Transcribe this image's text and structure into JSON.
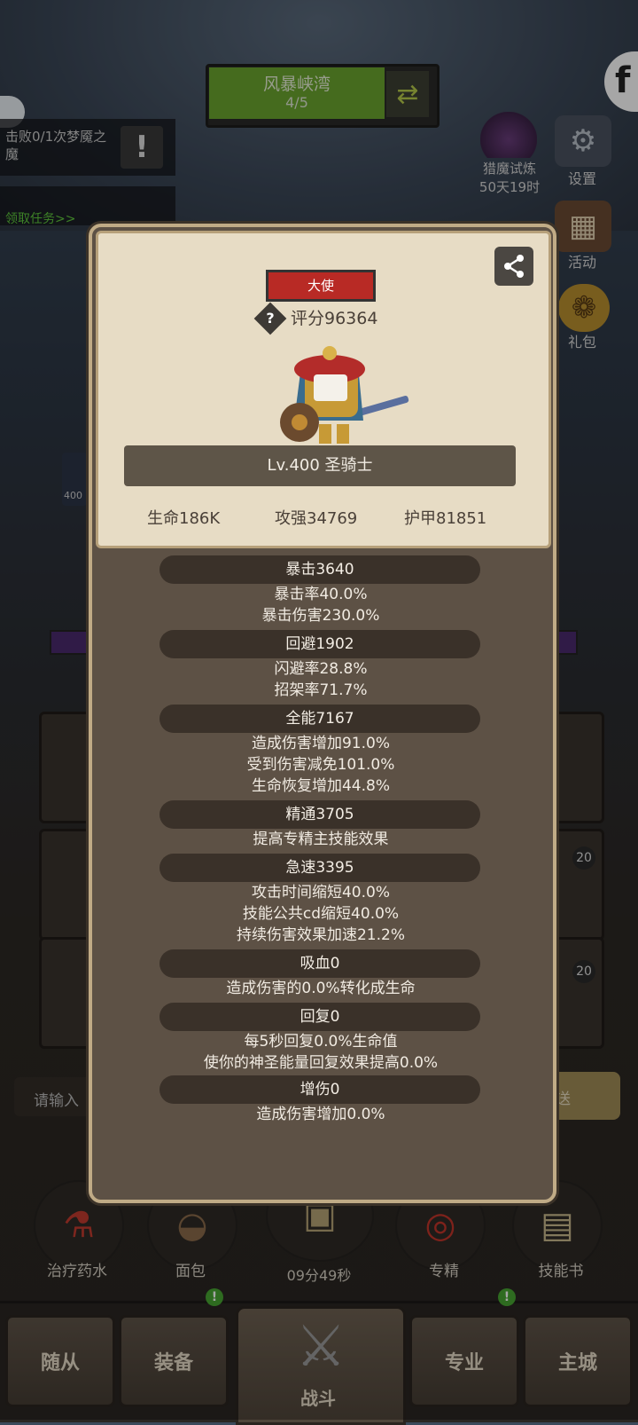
{
  "zone": {
    "title": "风暴峡湾",
    "progress": "4/5"
  },
  "quests": [
    {
      "text": "击败0/1次梦魇之魔"
    },
    {
      "text": "领取任务>>"
    }
  ],
  "hunt_trial": {
    "title": "猎魔试炼",
    "remaining": "50天19时"
  },
  "side_menu": [
    {
      "label": "设置",
      "icon": "gear-icon"
    },
    {
      "label": "活动",
      "icon": "calendar-icon"
    },
    {
      "label": "礼包",
      "icon": "gift-icon"
    }
  ],
  "badges": {
    "level_label": "400",
    "slot_a": "20",
    "slot_b": "20"
  },
  "chat": {
    "placeholder": "请输入",
    "send_label": "发送"
  },
  "character": {
    "rank": "大使",
    "score": "评分96364",
    "level_class": "Lv.400 圣骑士",
    "health": "生命186K",
    "power": "攻强34769",
    "armor": "护甲81851"
  },
  "stats": [
    {
      "title": "暴击3640",
      "lines": [
        "暴击率40.0%",
        "暴击伤害230.0%"
      ]
    },
    {
      "title": "回避1902",
      "lines": [
        "闪避率28.8%",
        "招架率71.7%"
      ]
    },
    {
      "title": "全能7167",
      "lines": [
        "造成伤害增加91.0%",
        "受到伤害减免101.0%",
        "生命恢复增加44.8%"
      ]
    },
    {
      "title": "精通3705",
      "lines": [
        "提高专精主技能效果"
      ]
    },
    {
      "title": "急速3395",
      "lines": [
        "攻击时间缩短40.0%",
        "技能公共cd缩短40.0%",
        "持续伤害效果加速21.2%"
      ]
    },
    {
      "title": "吸血0",
      "lines": [
        "造成伤害的0.0%转化成生命"
      ]
    },
    {
      "title": "回复0",
      "lines": [
        "每5秒回复0.0%生命值",
        "使你的神圣能量回复效果提高0.0%"
      ]
    },
    {
      "title": "增伤0",
      "lines": [
        "造成伤害增加0.0%"
      ]
    }
  ],
  "items": [
    {
      "label": "治疗药水"
    },
    {
      "label": "面包"
    },
    {
      "label": "专精"
    },
    {
      "label": "技能书"
    }
  ],
  "timer": "09分49秒",
  "nav": [
    {
      "label": "随从"
    },
    {
      "label": "装备"
    },
    {
      "label": "战斗"
    },
    {
      "label": "专业"
    },
    {
      "label": "主城"
    }
  ],
  "nav_notice": "!",
  "colors": {
    "modal_bg": "#5d5145",
    "card_bg": "#e7dcc5",
    "rank_red": "#b82a25",
    "brush_dark": "#3a3129",
    "zone_green": "#6aa52e"
  }
}
